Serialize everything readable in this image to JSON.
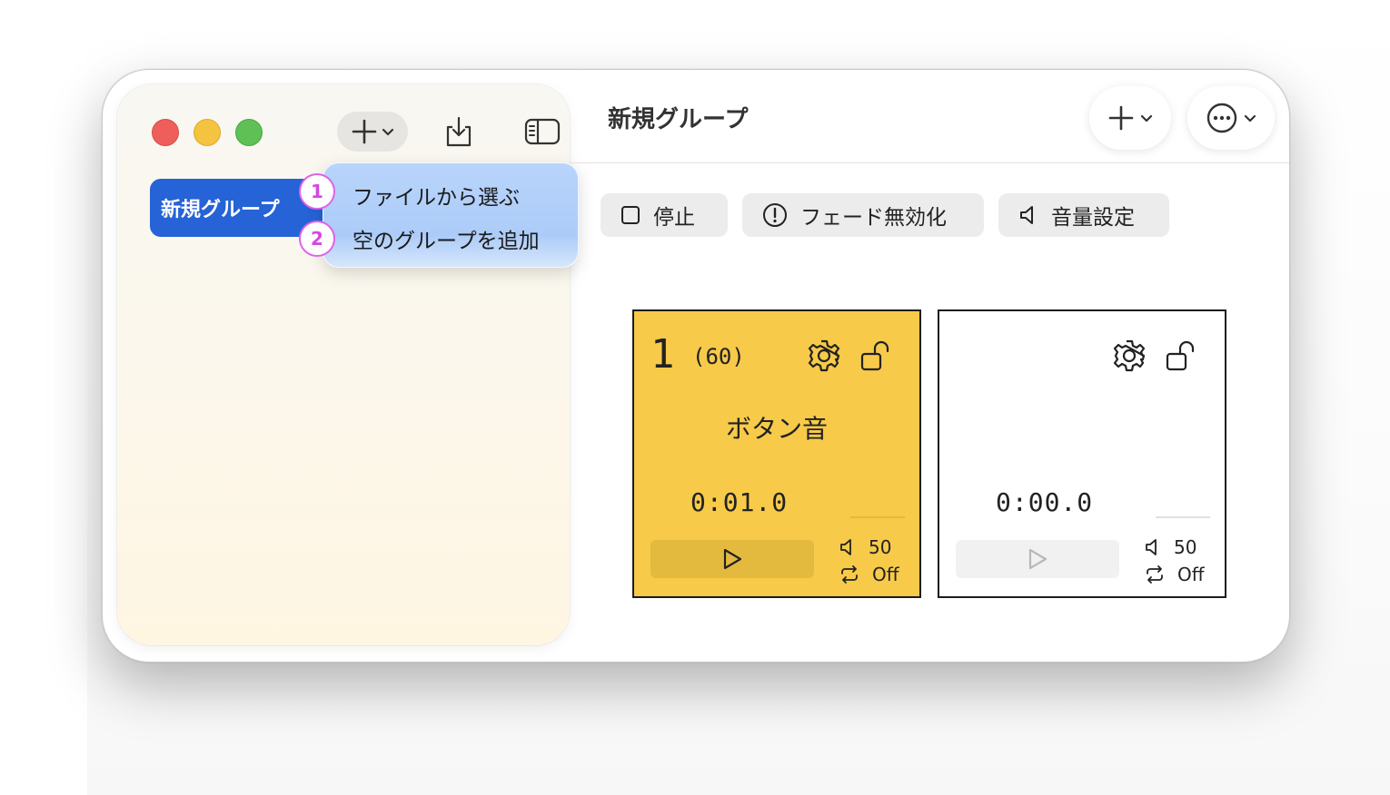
{
  "sidebar": {
    "window_controls": [
      "close",
      "minimize",
      "maximize"
    ],
    "toolbar": {
      "add_icon": "plus-icon",
      "add_chevron_icon": "chevron-down-icon",
      "import_icon": "download-tray-icon",
      "toggle_icon": "sidebar-toggle-icon"
    },
    "groups": [
      {
        "label": "新規グループ",
        "selected": true
      }
    ],
    "add_menu": {
      "items": [
        {
          "badge": "1",
          "label": "ファイルから選ぶ"
        },
        {
          "badge": "2",
          "label": "空のグループを追加"
        }
      ]
    }
  },
  "main": {
    "title": "新規グループ",
    "toolbar": {
      "add_icon": "plus-icon",
      "more_icon": "ellipsis-circle-icon"
    },
    "controls": {
      "stop_label": "停止",
      "fade_label": "フェード無効化",
      "volume_label": "音量設定"
    },
    "cards": [
      {
        "number": "1",
        "count": "(60)",
        "name": "ボタン音",
        "time": "0:01.0",
        "volume": "50",
        "loop": "Off",
        "color": "#f7ca49"
      },
      {
        "number": "",
        "count": "",
        "name": "",
        "time": "0:00.0",
        "volume": "50",
        "loop": "Off",
        "color": "#ffffff"
      }
    ]
  },
  "colors": {
    "accent": "#2563d6",
    "badge": "#e061e8",
    "card_active": "#f7ca49"
  }
}
